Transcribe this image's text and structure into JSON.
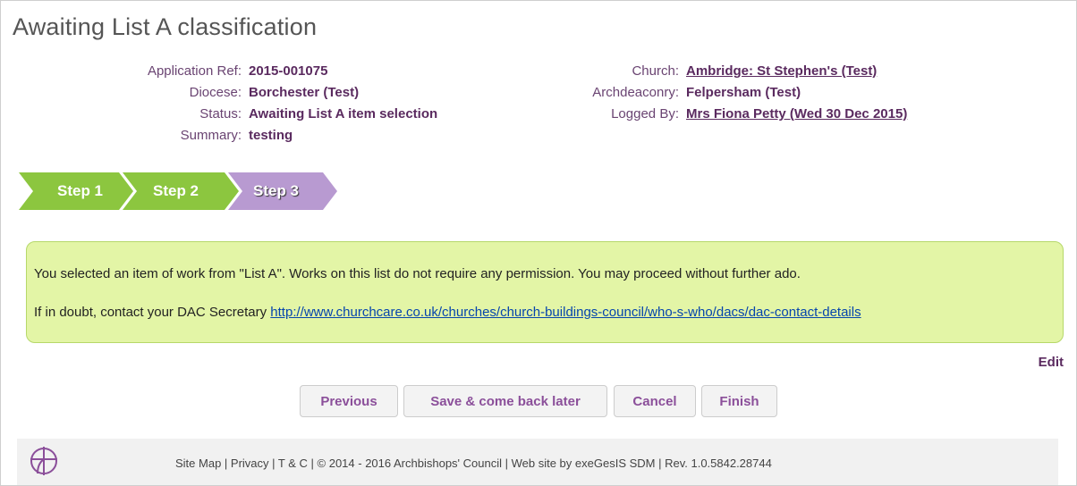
{
  "page": {
    "title": "Awaiting List A classification"
  },
  "meta_left": [
    {
      "label": "Application Ref:",
      "value": "2015-001075"
    },
    {
      "label": "Diocese:",
      "value": "Borchester (Test)"
    },
    {
      "label": "Status:",
      "value": "Awaiting List A item selection"
    },
    {
      "label": "Summary:",
      "value": "testing"
    }
  ],
  "meta_right": [
    {
      "label": "Church:",
      "value": "Ambridge: St Stephen's (Test)"
    },
    {
      "label": "Archdeaconry:",
      "value": "Felpersham (Test)"
    },
    {
      "label": "Logged By:",
      "value": "Mrs Fiona Petty (Wed 30 Dec 2015)"
    }
  ],
  "steps": [
    {
      "label": "Step 1",
      "state": "completed",
      "color": "#8cc63f"
    },
    {
      "label": "Step 2",
      "state": "completed",
      "color": "#8cc63f"
    },
    {
      "label": "Step 3",
      "state": "current",
      "color": "#b89ad1"
    }
  ],
  "notice": {
    "line1": "You selected an item of work from \"List A\". Works on this list do not require any permission. You may proceed without further ado.",
    "line2_prefix": "If in doubt, contact your DAC Secretary",
    "line2_link": "http://www.churchcare.co.uk/churches/church-buildings-council/who-s-who/dacs/dac-contact-details"
  },
  "edit_label": "Edit",
  "buttons": {
    "previous": "Previous",
    "save": "Save & come back later",
    "cancel": "Cancel",
    "finish": "Finish"
  },
  "footer": {
    "logo_icon": "church-cross-logo-icon",
    "site_map": "Site Map",
    "sep1": " | ",
    "privacy": "Privacy",
    "sep2": " | ",
    "tc": "T & C",
    "sep3": " | ",
    "copyright": "© 2014 - 2016 Archbishops' Council",
    "sep4": " | ",
    "credit": "Web site by exeGesIS SDM",
    "sep5": " | ",
    "revision": "Rev. 1.0.5842.28744"
  },
  "colors": {
    "accent_purple": "#5a2a5f",
    "button_text": "#8b4f9a",
    "notice_bg": "#e3f5a6",
    "step_green": "#8cc63f",
    "step_purple": "#b89ad1",
    "link_blue": "#0645ad"
  }
}
